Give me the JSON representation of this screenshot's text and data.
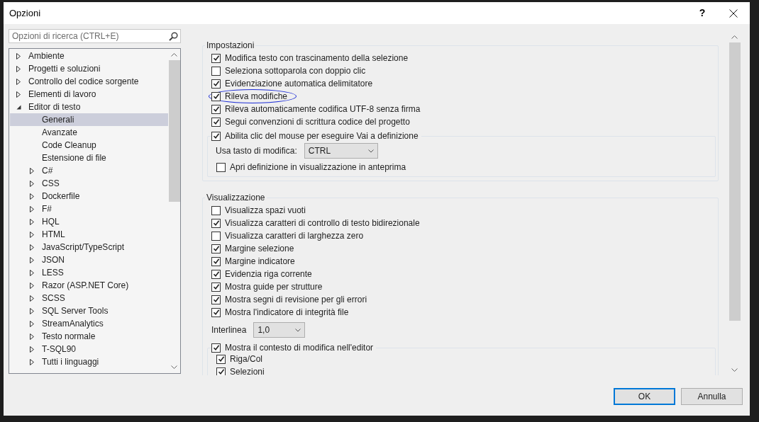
{
  "window": {
    "title": "Opzioni",
    "help": "?"
  },
  "search": {
    "placeholder": "Opzioni di ricerca (CTRL+E)"
  },
  "tree": [
    {
      "label": "Ambiente",
      "expanded": false,
      "selected": false
    },
    {
      "label": "Progetti e soluzioni",
      "expanded": false,
      "selected": false
    },
    {
      "label": "Controllo del codice sorgente",
      "expanded": false,
      "selected": false
    },
    {
      "label": "Elementi di lavoro",
      "expanded": false,
      "selected": false
    },
    {
      "label": "Editor di testo",
      "expanded": true,
      "selected": false,
      "children": [
        {
          "label": "Generali",
          "selected": true
        },
        {
          "label": "Avanzate",
          "selected": false
        },
        {
          "label": "Code Cleanup",
          "selected": false
        },
        {
          "label": "Estensione di file",
          "selected": false
        },
        {
          "label": "C#",
          "expanded": false,
          "selected": false
        },
        {
          "label": "CSS",
          "expanded": false,
          "selected": false
        },
        {
          "label": "Dockerfile",
          "expanded": false,
          "selected": false
        },
        {
          "label": "F#",
          "expanded": false,
          "selected": false
        },
        {
          "label": "HQL",
          "expanded": false,
          "selected": false
        },
        {
          "label": "HTML",
          "expanded": false,
          "selected": false
        },
        {
          "label": "JavaScript/TypeScript",
          "expanded": false,
          "selected": false
        },
        {
          "label": "JSON",
          "expanded": false,
          "selected": false
        },
        {
          "label": "LESS",
          "expanded": false,
          "selected": false
        },
        {
          "label": "Razor (ASP.NET Core)",
          "expanded": false,
          "selected": false
        },
        {
          "label": "SCSS",
          "expanded": false,
          "selected": false
        },
        {
          "label": "SQL Server Tools",
          "expanded": false,
          "selected": false
        },
        {
          "label": "StreamAnalytics",
          "expanded": false,
          "selected": false
        },
        {
          "label": "Testo normale",
          "expanded": false,
          "selected": false
        },
        {
          "label": "T-SQL90",
          "expanded": false,
          "selected": false
        },
        {
          "label": "Tutti i linguaggi",
          "expanded": false,
          "selected": false
        }
      ]
    }
  ],
  "sections": [
    {
      "title": "Impostazioni",
      "items": [
        {
          "kind": "checkbox",
          "label": "Modifica testo con trascinamento della selezione",
          "checked": true
        },
        {
          "kind": "checkbox",
          "label": "Seleziona sottoparola con doppio clic",
          "checked": false
        },
        {
          "kind": "checkbox",
          "label": "Evidenziazione automatica delimitatore",
          "checked": true
        },
        {
          "kind": "checkbox",
          "label": "Rileva modifiche",
          "checked": true,
          "annotated": true
        },
        {
          "kind": "checkbox",
          "label": "Rileva automaticamente codifica UTF-8 senza firma",
          "checked": true
        },
        {
          "kind": "checkbox",
          "label": "Segui convenzioni di scrittura codice del progetto",
          "checked": true
        },
        {
          "kind": "group",
          "label": "Abilita clic del mouse per eseguire Vai a definizione",
          "checked": true,
          "items": [
            {
              "kind": "dropdown",
              "label": "Usa tasto di modifica:",
              "value": "CTRL"
            },
            {
              "kind": "checkbox",
              "label": "Apri definizione in visualizzazione in anteprima",
              "checked": false
            }
          ]
        }
      ]
    },
    {
      "title": "Visualizzazione",
      "items": [
        {
          "kind": "checkbox",
          "label": "Visualizza spazi vuoti",
          "checked": false
        },
        {
          "kind": "checkbox",
          "label": "Visualizza caratteri di controllo di testo bidirezionale",
          "checked": true
        },
        {
          "kind": "checkbox",
          "label": "Visualizza caratteri di larghezza zero",
          "checked": false
        },
        {
          "kind": "checkbox",
          "label": "Margine selezione",
          "checked": true
        },
        {
          "kind": "checkbox",
          "label": "Margine indicatore",
          "checked": true
        },
        {
          "kind": "checkbox",
          "label": "Evidenzia riga corrente",
          "checked": true
        },
        {
          "kind": "checkbox",
          "label": "Mostra guide per strutture",
          "checked": true
        },
        {
          "kind": "checkbox",
          "label": "Mostra segni di revisione per gli errori",
          "checked": true
        },
        {
          "kind": "checkbox",
          "label": "Mostra l'indicatore di integrità file",
          "checked": true
        },
        {
          "kind": "dropdown",
          "label": "Interlinea",
          "value": "1,0"
        },
        {
          "kind": "group",
          "label": "Mostra il contesto di modifica nell'editor",
          "checked": true,
          "items": [
            {
              "kind": "checkbox",
              "label": "Riga/Col",
              "checked": true
            },
            {
              "kind": "checkbox",
              "label": "Selezioni",
              "checked": true
            }
          ]
        }
      ]
    }
  ],
  "buttons": [
    {
      "label": "OK",
      "default": true
    },
    {
      "label": "Annulla",
      "default": false
    }
  ]
}
